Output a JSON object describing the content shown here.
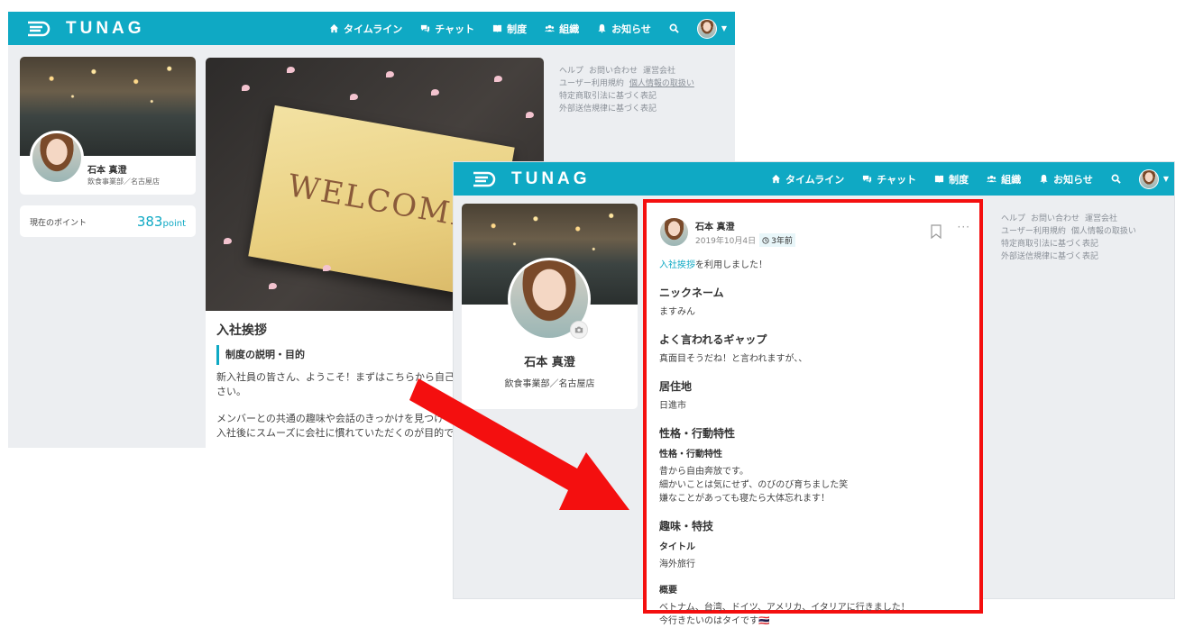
{
  "brand": {
    "name": "TUNAG",
    "accent": "#0fa9c4",
    "highlight": "#f40f0f"
  },
  "nav": {
    "items": [
      {
        "label": "タイムライン",
        "icon": "home-icon"
      },
      {
        "label": "チャット",
        "icon": "chat-icon"
      },
      {
        "label": "制度",
        "icon": "book-icon"
      },
      {
        "label": "組織",
        "icon": "people-icon"
      },
      {
        "label": "お知らせ",
        "icon": "bell-icon"
      }
    ]
  },
  "footer": {
    "help": "ヘルプ",
    "contact": "お問い合わせ",
    "company": "運営会社",
    "terms": "ユーザー利用規約",
    "privacy": "個人情報の取扱い",
    "commerce": "特定商取引法に基づく表記",
    "external": "外部送信規律に基づく表記"
  },
  "profile": {
    "name": "石本 真澄",
    "department": "飲食事業部／名古屋店",
    "points_label": "現在のポイント",
    "points_value": "383",
    "points_unit": "point"
  },
  "welcome": {
    "image_word": "WELCOME",
    "title": "入社挨拶",
    "section_heading": "制度の説明・目的",
    "para1": "新入社員の皆さん、ようこそ！まずはこちらから自己\nさい。",
    "para2": "メンバーとの共通の趣味や会話のきっかけを見つけ\n入社後にスムーズに会社に慣れていただくのが目的で"
  },
  "post": {
    "author": "石本 真澄",
    "date": "2019年10月4日",
    "relative": "3年前",
    "intro_link": "入社挨拶",
    "intro_rest": "を利用しました！",
    "sections": {
      "nickname_h": "ニックネーム",
      "nickname": "ますみん",
      "gap_h": "よく言われるギャップ",
      "gap": "真面目そうだね！と言われますが、、",
      "home_h": "居住地",
      "home": "日進市",
      "personality_h": "性格・行動特性",
      "personality_sub": "性格・行動特性",
      "personality": "昔から自由奔放です。\n細かいことは気にせず、のびのび育ちました笑\n嫌なことがあっても寝たら大体忘れます！",
      "hobby_h": "趣味・特技",
      "title_sub": "タイトル",
      "title_val": "海外旅行",
      "summary_sub": "概要",
      "summary": "ベトナム、台湾、ドイツ、アメリカ、イタリアに行きました！\n今行きたいのはタイです🇹🇭"
    }
  }
}
